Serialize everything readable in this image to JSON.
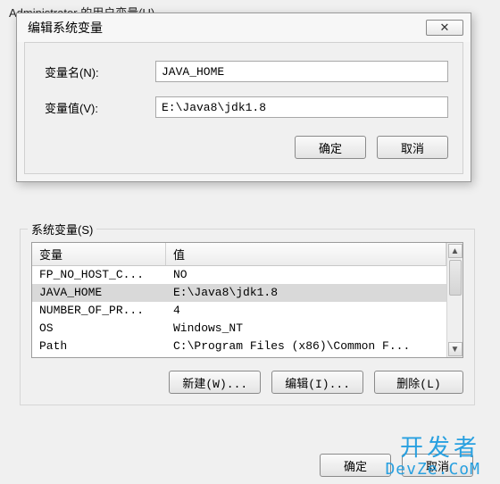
{
  "parent_header": "Administrator 的用户变量(U)",
  "edit_dialog": {
    "title": "编辑系统变量",
    "close_glyph": "✕",
    "name_label": "变量名(N):",
    "name_value": "JAVA_HOME",
    "value_label": "变量值(V):",
    "value_value": "E:\\Java8\\jdk1.8",
    "ok": "确定",
    "cancel": "取消"
  },
  "sysvars": {
    "group_label": "系统变量(S)",
    "header_var": "变量",
    "header_val": "值",
    "rows": [
      {
        "var": "FP_NO_HOST_C...",
        "val": "NO",
        "selected": false
      },
      {
        "var": "JAVA_HOME",
        "val": "E:\\Java8\\jdk1.8",
        "selected": true
      },
      {
        "var": "NUMBER_OF_PR...",
        "val": "4",
        "selected": false
      },
      {
        "var": "OS",
        "val": "Windows_NT",
        "selected": false
      },
      {
        "var": "Path",
        "val": "C:\\Program Files (x86)\\Common F...",
        "selected": false
      }
    ],
    "new_btn": "新建(W)...",
    "edit_btn": "编辑(I)...",
    "delete_btn": "删除(L)"
  },
  "bottom": {
    "ok": "确定",
    "cancel": "取消"
  },
  "watermark": {
    "line1": "开发者",
    "line2": "DevZe.CoM"
  }
}
